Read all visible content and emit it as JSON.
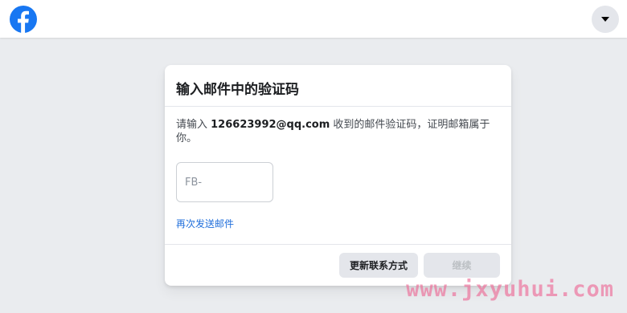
{
  "header": {
    "logo_icon": "facebook-logo-icon",
    "menu_icon": "caret-down-icon"
  },
  "card": {
    "title": "输入邮件中的验证码",
    "desc_prefix": "请输入 ",
    "email": "126623992@qq.com",
    "desc_suffix": " 收到的邮件验证码，证明邮箱属于你。",
    "code_input": {
      "placeholder": "FB-",
      "value": ""
    },
    "resend_link": "再次发送邮件",
    "update_contact_button": "更新联系方式",
    "continue_button": "继续"
  },
  "watermark": "www.jxyuhui.com",
  "colors": {
    "brand": "#1877f2",
    "link": "#216fdb",
    "background": "#eaecef",
    "watermark": "#ec6c96"
  }
}
